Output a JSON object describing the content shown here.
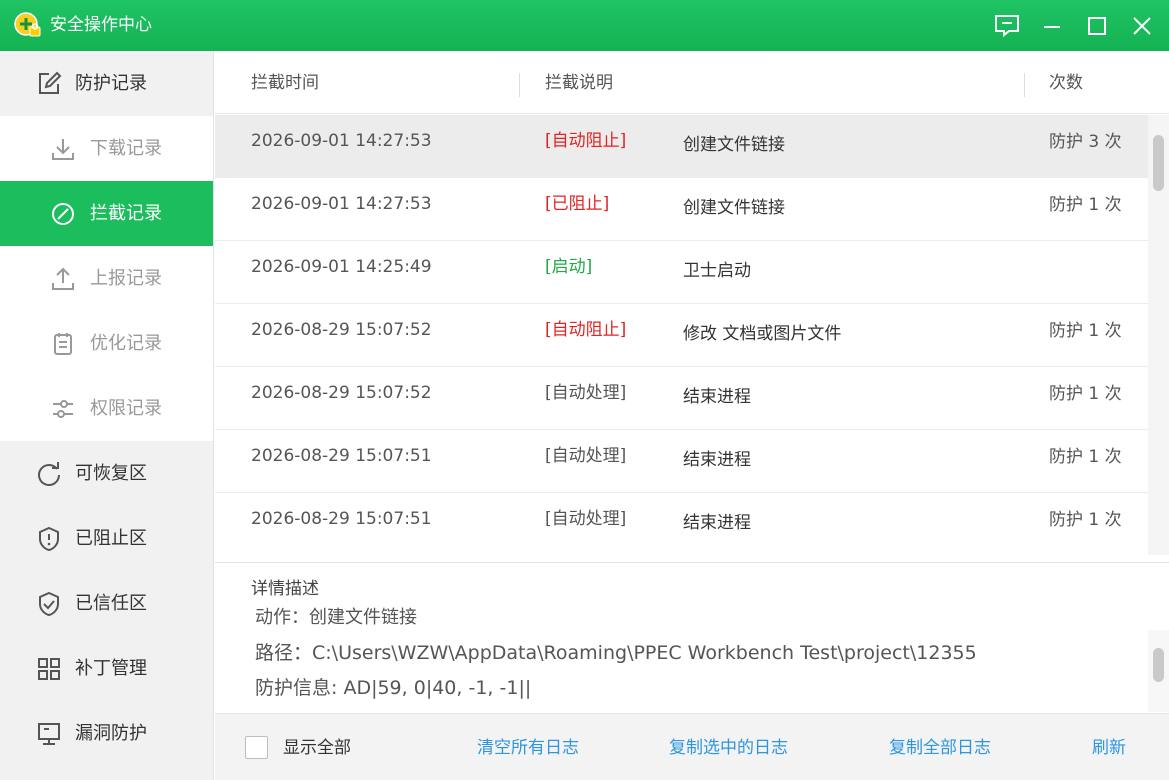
{
  "window": {
    "title": "安全操作中心",
    "accent": "#1cbd5c"
  },
  "sidebar": {
    "items": [
      {
        "label": "防护记录",
        "icon": "edit-icon"
      },
      {
        "label": "下载记录",
        "icon": "download-icon"
      },
      {
        "label": "拦截记录",
        "icon": "block-icon"
      },
      {
        "label": "上报记录",
        "icon": "upload-icon"
      },
      {
        "label": "优化记录",
        "icon": "clipboard-icon"
      },
      {
        "label": "权限记录",
        "icon": "sliders-icon"
      },
      {
        "label": "可恢复区",
        "icon": "refresh-icon"
      },
      {
        "label": "已阻止区",
        "icon": "shield-alert-icon"
      },
      {
        "label": "已信任区",
        "icon": "shield-check-icon"
      },
      {
        "label": "补丁管理",
        "icon": "grid-icon"
      },
      {
        "label": "漏洞防护",
        "icon": "monitor-icon"
      }
    ]
  },
  "table": {
    "columns": [
      "拦截时间",
      "拦截说明",
      "次数"
    ],
    "rows": [
      {
        "time": "2026-09-01 14:27:53",
        "tag": "[自动阻止]",
        "tag_color": "red",
        "desc": "创建文件链接",
        "count": "防护 3 次"
      },
      {
        "time": "2026-09-01 14:27:53",
        "tag": "[已阻止]",
        "tag_color": "red",
        "desc": "创建文件链接",
        "count": "防护 1 次"
      },
      {
        "time": "2026-09-01 14:25:49",
        "tag": "[启动]",
        "tag_color": "green",
        "desc": "卫士启动",
        "count": ""
      },
      {
        "time": "2026-08-29 15:07:52",
        "tag": "[自动阻止]",
        "tag_color": "red",
        "desc": "修改 文档或图片文件",
        "count": "防护 1 次"
      },
      {
        "time": "2026-08-29 15:07:52",
        "tag": "[自动处理]",
        "tag_color": "gray",
        "desc": "结束进程",
        "count": "防护 1 次"
      },
      {
        "time": "2026-08-29 15:07:51",
        "tag": "[自动处理]",
        "tag_color": "gray",
        "desc": "结束进程",
        "count": "防护 1 次"
      },
      {
        "time": "2026-08-29 15:07:51",
        "tag": "[自动处理]",
        "tag_color": "gray",
        "desc": "结束进程",
        "count": "防护 1 次"
      }
    ]
  },
  "details": {
    "title": "详情描述",
    "action": "动作：创建文件链接",
    "path": "路径：C:\\Users\\WZW\\AppData\\Roaming\\PPEC Workbench Test\\project\\12355",
    "info": "防护信息: AD|59, 0|40, -1, -1||"
  },
  "footer": {
    "show_all": "显示全部",
    "clear_all": "清空所有日志",
    "copy_selected": "复制选中的日志",
    "copy_all": "复制全部日志",
    "refresh": "刷新"
  },
  "colors": {
    "red": "#e02424",
    "green": "#22a845",
    "link": "#2d96e0"
  }
}
